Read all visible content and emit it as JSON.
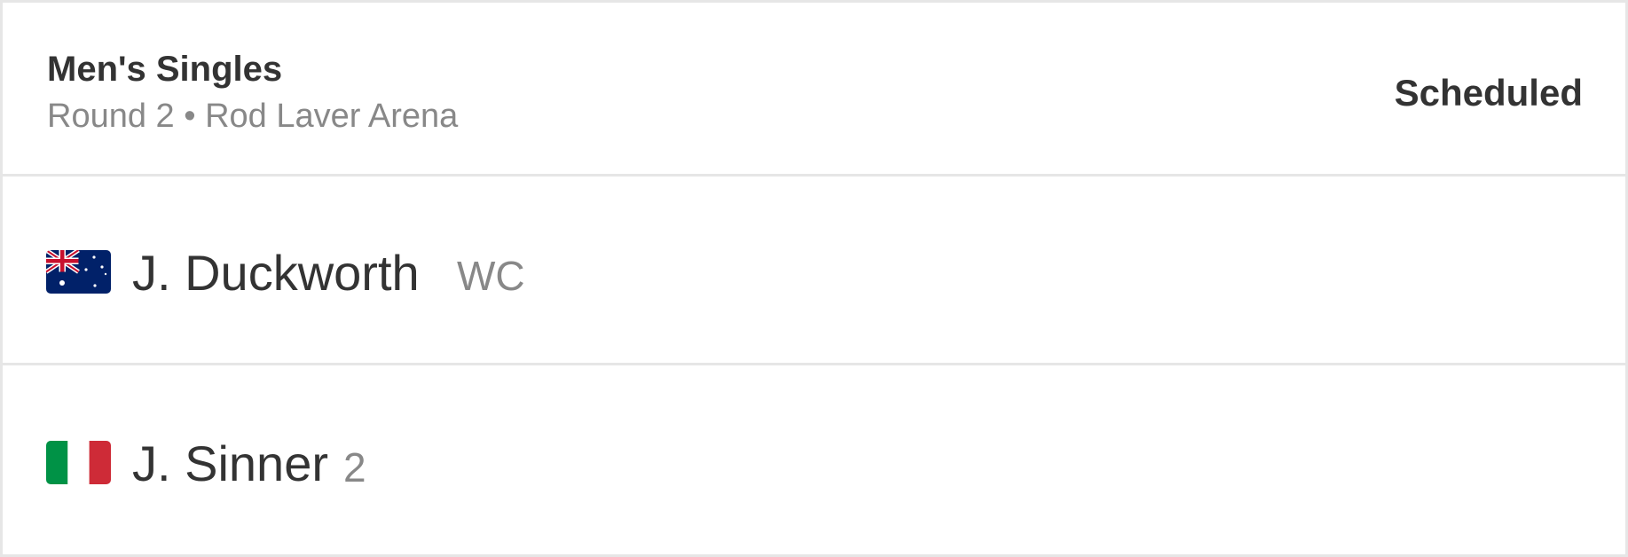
{
  "match": {
    "event": "Men's Singles",
    "details": "Round 2 • Rod Laver Arena",
    "status": "Scheduled"
  },
  "players": [
    {
      "name": "J. Duckworth",
      "tag": "WC",
      "flag_icon": "australia-flag-icon"
    },
    {
      "name": "J. Sinner",
      "tag": "2",
      "flag_icon": "italy-flag-icon"
    }
  ],
  "colors": {
    "text_primary": "#333333",
    "text_secondary": "#888888",
    "divider": "#e6e6e6",
    "australia_blue": "#012169",
    "italy_green": "#009246",
    "italy_red": "#CE2B37"
  }
}
